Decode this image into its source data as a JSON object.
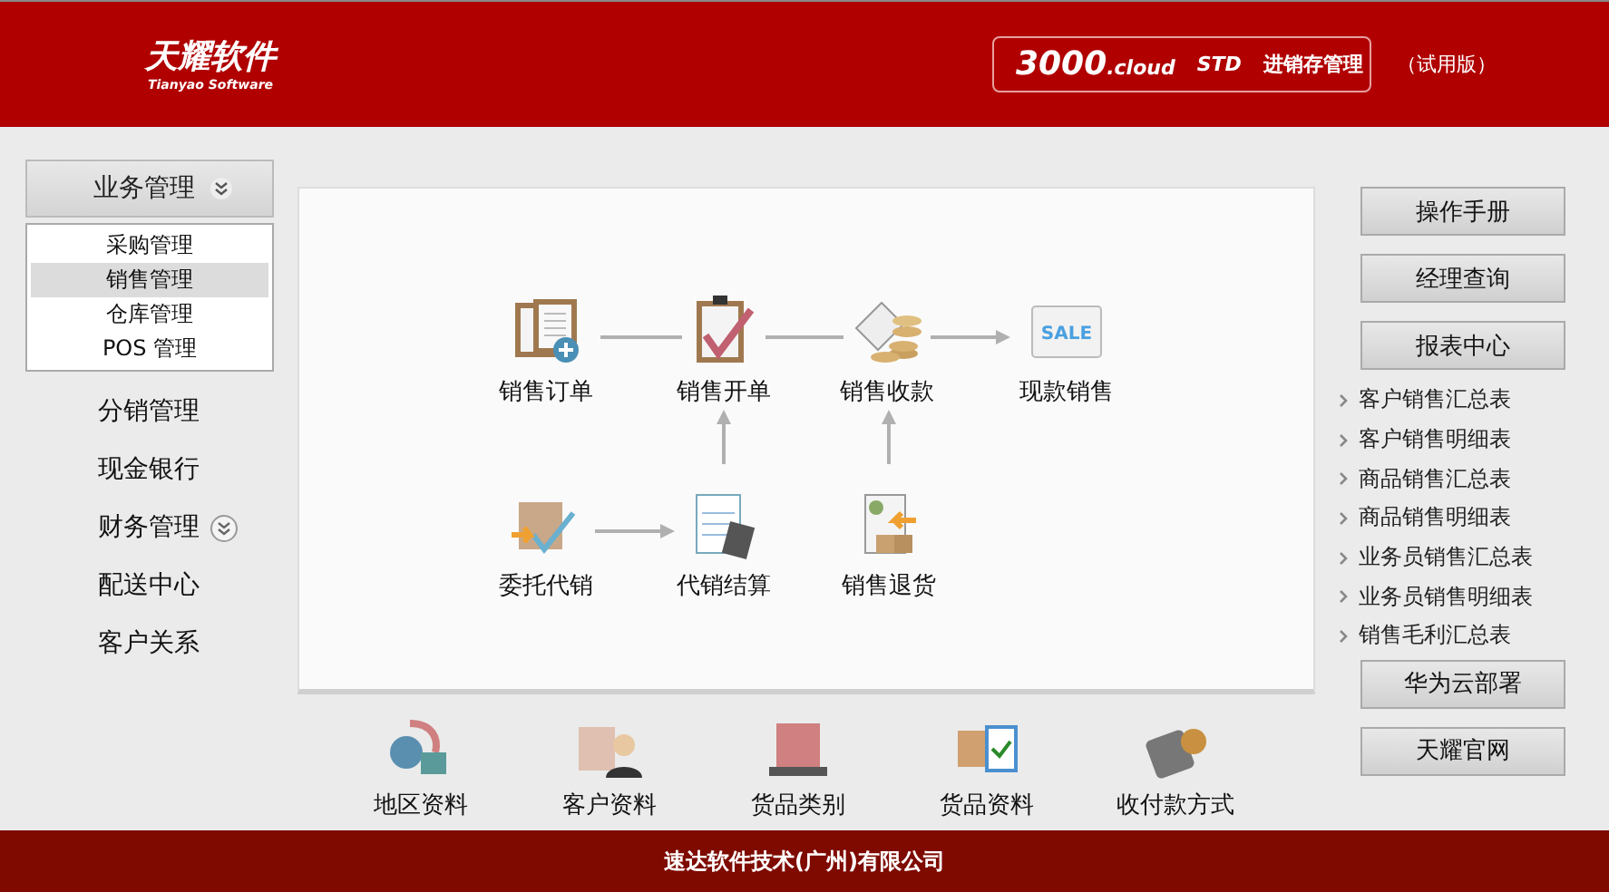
{
  "header": {
    "logo": "天耀软件",
    "logo_subtitle": "Tianyao Software",
    "product": {
      "version": "3000",
      "edition_suffix": ".cloud",
      "tier": "STD",
      "name": "进销存管理"
    },
    "trial_label": "（试用版）"
  },
  "sidebar": {
    "groups": [
      {
        "label": "业务管理",
        "kind": "header",
        "expanded": true,
        "children": [
          {
            "label": "采购管理",
            "selected": false
          },
          {
            "label": "销售管理",
            "selected": true
          },
          {
            "label": "仓库管理",
            "selected": false
          },
          {
            "label": "POS 管理",
            "selected": false
          }
        ]
      },
      {
        "label": "分销管理",
        "kind": "plain"
      },
      {
        "label": "现金银行",
        "kind": "plain"
      },
      {
        "label": "财务管理",
        "kind": "collapsible",
        "expanded": false
      },
      {
        "label": "配送中心",
        "kind": "plain"
      },
      {
        "label": "客户关系",
        "kind": "plain"
      }
    ]
  },
  "flow": {
    "nodes": [
      {
        "label": "销售订单"
      },
      {
        "label": "销售开单"
      },
      {
        "label": "销售收款"
      },
      {
        "label": "现款销售",
        "icon_text": "SALE"
      },
      {
        "label": "委托代销"
      },
      {
        "label": "代销结算"
      },
      {
        "label": "销售退货"
      }
    ]
  },
  "shortcuts": [
    {
      "label": "地区资料"
    },
    {
      "label": "客户资料"
    },
    {
      "label": "货品类别"
    },
    {
      "label": "货品资料"
    },
    {
      "label": "收付款方式"
    }
  ],
  "right_panel": {
    "top_buttons": [
      "操作手册",
      "经理查询",
      "报表中心"
    ],
    "reports": [
      "客户销售汇总表",
      "客户销售明细表",
      "商品销售汇总表",
      "商品销售明细表",
      "业务员销售汇总表",
      "业务员销售明细表",
      "销售毛利汇总表"
    ],
    "bottom_buttons": [
      "华为云部署",
      "天耀官网"
    ]
  },
  "footer": "速达软件技术(广州)有限公司"
}
